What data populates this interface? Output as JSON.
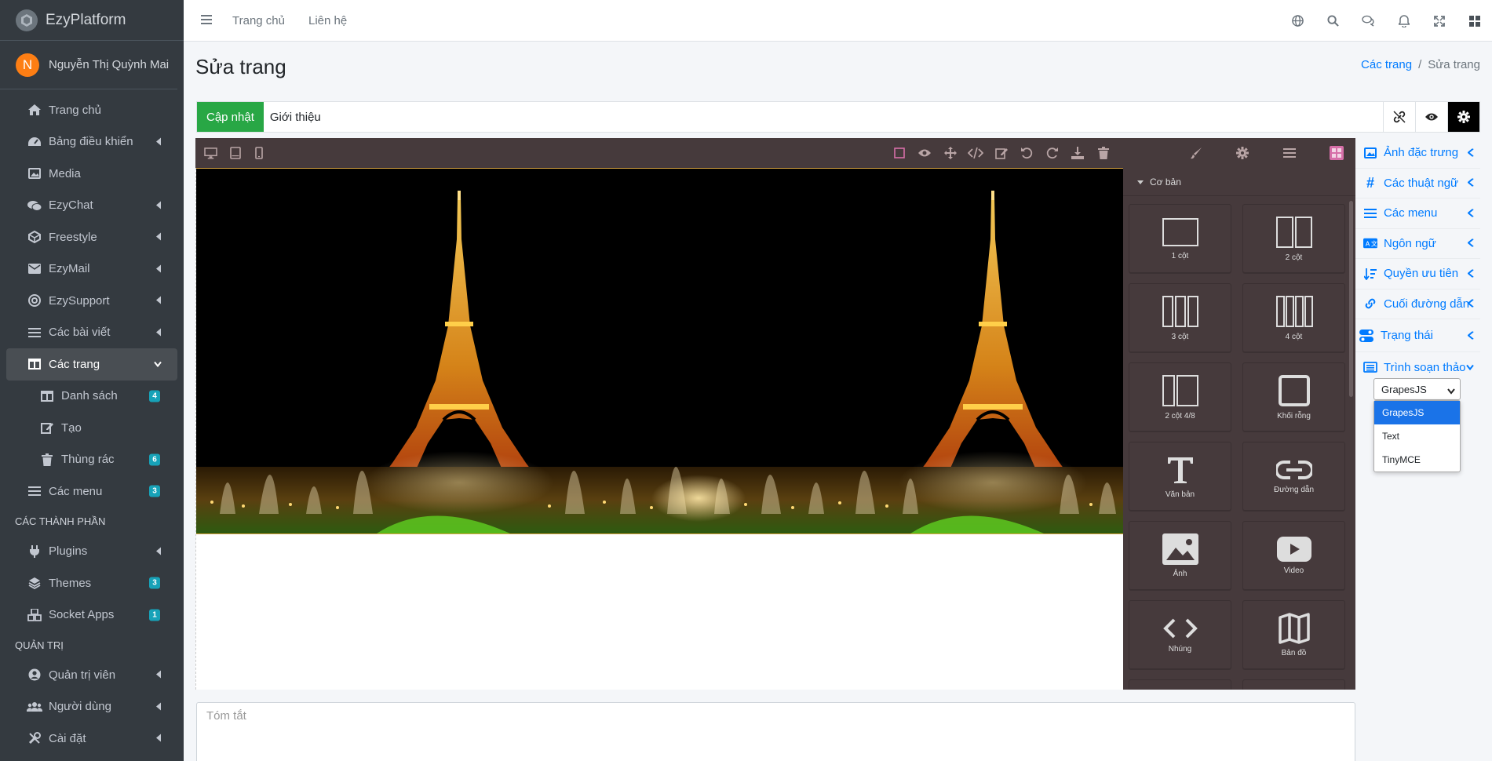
{
  "brand": {
    "name": "EzyPlatform"
  },
  "user": {
    "initial": "N",
    "name": "Nguyễn Thị Quỳnh Mai"
  },
  "sidebar": {
    "items": [
      {
        "label": "Trang chủ"
      },
      {
        "label": "Bảng điều khiển"
      },
      {
        "label": "Media"
      },
      {
        "label": "EzyChat"
      },
      {
        "label": "Freestyle"
      },
      {
        "label": "EzyMail"
      },
      {
        "label": "EzySupport"
      },
      {
        "label": "Các bài viết"
      },
      {
        "label": "Các trang"
      },
      {
        "label": "Danh sách",
        "badge": "4"
      },
      {
        "label": "Tạo"
      },
      {
        "label": "Thùng rác",
        "badge": "6"
      },
      {
        "label": "Các menu",
        "badge": "3"
      },
      {
        "label": "Plugins"
      },
      {
        "label": "Themes",
        "badge": "3"
      },
      {
        "label": "Socket Apps",
        "badge": "1"
      },
      {
        "label": "Quản trị viên"
      },
      {
        "label": "Người dùng"
      },
      {
        "label": "Cài đặt"
      }
    ],
    "headers": {
      "components": "CÁC THÀNH PHẦN",
      "admin": "QUẢN TRỊ"
    }
  },
  "topbar": {
    "home": "Trang chủ",
    "contact": "Liên hệ"
  },
  "page": {
    "title": "Sửa trang"
  },
  "breadcrumb": {
    "parent": "Các trang",
    "current": "Sửa trang"
  },
  "form": {
    "update_label": "Cập nhật",
    "title_value": "Giới thiệu",
    "summary_placeholder": "Tóm tắt"
  },
  "blocks": {
    "category": "Cơ bản",
    "items": [
      {
        "label": "1 cột"
      },
      {
        "label": "2 cột"
      },
      {
        "label": "3 cột"
      },
      {
        "label": "4 cột"
      },
      {
        "label": "2 cột 4/8"
      },
      {
        "label": "Khối rỗng"
      },
      {
        "label": "Văn bản"
      },
      {
        "label": "Đường dẫn"
      },
      {
        "label": "Ảnh"
      },
      {
        "label": "Video"
      },
      {
        "label": "Nhúng"
      },
      {
        "label": "Bản đồ"
      }
    ]
  },
  "right_panel": {
    "items": [
      {
        "label": "Ảnh đặc trưng"
      },
      {
        "label": "Các thuật ngữ"
      },
      {
        "label": "Các menu"
      },
      {
        "label": "Ngôn ngữ"
      },
      {
        "label": "Quyền ưu tiên"
      },
      {
        "label": "Cuối đường dẫn"
      },
      {
        "label": "Trạng thái"
      },
      {
        "label": "Trình soạn thảo"
      }
    ],
    "editor_select": {
      "value": "GrapesJS",
      "options": [
        "GrapesJS",
        "Text",
        "TinyMCE"
      ]
    }
  },
  "colors": {
    "sidebar_bg": "#343a40",
    "accent": "#007bff",
    "success": "#28a745",
    "editor_bg": "#463a3c",
    "badge": "#17a2b8"
  }
}
